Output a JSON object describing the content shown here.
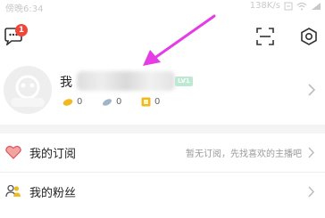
{
  "status_bar": {
    "time": "傍晚6:34",
    "speed": "138K/s"
  },
  "topbar": {
    "message_badge": "1"
  },
  "profile": {
    "name": "我",
    "level": "LV1",
    "stats": [
      {
        "icon": "gold-coin-icon",
        "value": "0"
      },
      {
        "icon": "feather-icon",
        "value": "0"
      },
      {
        "icon": "card-icon",
        "value": "0"
      }
    ]
  },
  "menu": {
    "items": [
      {
        "label": "我的订阅",
        "sub": "暂无订阅，先找喜欢的主播吧",
        "icon": "heart-icon"
      },
      {
        "label": "我的粉丝",
        "sub": "",
        "icon": "fans-icon"
      }
    ]
  },
  "colors": {
    "badge": "#f0453a",
    "annotation_arrow": "#e63ce6",
    "level_badge": "#bde8d2"
  }
}
